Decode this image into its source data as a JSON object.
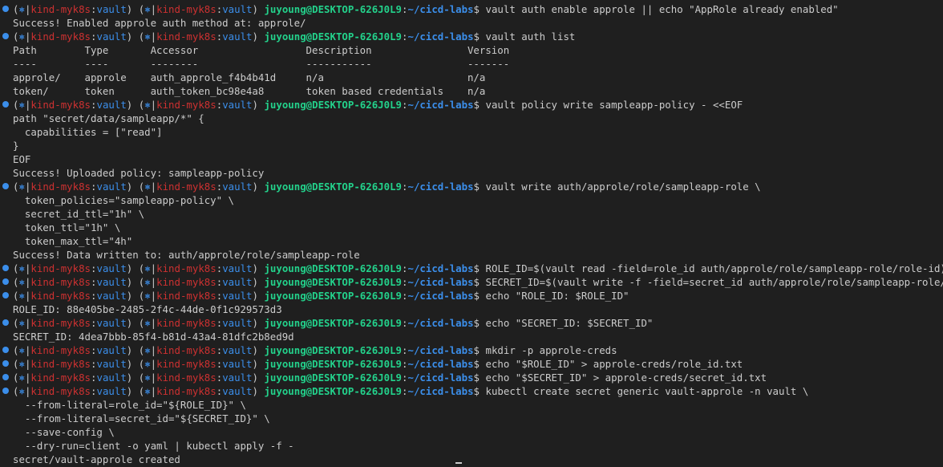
{
  "prompt": {
    "gear": "⎈",
    "bar": "|",
    "cluster": "kind-myk8s",
    "namespace": "vault",
    "user_host": "juyoung@DESKTOP-626J0L9",
    "cwd": "~/cicd-labs",
    "symbol": "$"
  },
  "lines": [
    {
      "kind": "prompt",
      "text": "vault auth enable approle || echo \"AppRole already enabled\""
    },
    {
      "kind": "output",
      "text": "Success! Enabled approle auth method at: approle/"
    },
    {
      "kind": "prompt",
      "text": "vault auth list"
    },
    {
      "kind": "output",
      "text": "Path        Type       Accessor                  Description                Version"
    },
    {
      "kind": "output",
      "text": "----        ----       --------                  -----------                -------"
    },
    {
      "kind": "output",
      "text": "approle/    approle    auth_approle_f4b4b41d     n/a                        n/a"
    },
    {
      "kind": "output",
      "text": "token/      token      auth_token_bc98e4a8       token based credentials    n/a"
    },
    {
      "kind": "prompt",
      "text": "vault policy write sampleapp-policy - <<EOF"
    },
    {
      "kind": "output",
      "text": "path \"secret/data/sampleapp/*\" {"
    },
    {
      "kind": "output",
      "text": "  capabilities = [\"read\"]"
    },
    {
      "kind": "output",
      "text": "}"
    },
    {
      "kind": "output",
      "text": "EOF"
    },
    {
      "kind": "output",
      "text": "Success! Uploaded policy: sampleapp-policy"
    },
    {
      "kind": "prompt",
      "text": "vault write auth/approle/role/sampleapp-role \\"
    },
    {
      "kind": "output",
      "text": "  token_policies=\"sampleapp-policy\" \\"
    },
    {
      "kind": "output",
      "text": "  secret_id_ttl=\"1h\" \\"
    },
    {
      "kind": "output",
      "text": "  token_ttl=\"1h\" \\"
    },
    {
      "kind": "output",
      "text": "  token_max_ttl=\"4h\""
    },
    {
      "kind": "output",
      "text": "Success! Data written to: auth/approle/role/sampleapp-role"
    },
    {
      "kind": "prompt",
      "text": "ROLE_ID=$(vault read -field=role_id auth/approle/role/sampleapp-role/role-id)"
    },
    {
      "kind": "prompt",
      "text": "SECRET_ID=$(vault write -f -field=secret_id auth/approle/role/sampleapp-role/secret-id)"
    },
    {
      "kind": "prompt",
      "text": "echo \"ROLE_ID: $ROLE_ID\""
    },
    {
      "kind": "output",
      "text": "ROLE_ID: 88e405be-2485-2f4c-44de-0f1c929573d3"
    },
    {
      "kind": "prompt",
      "text": "echo \"SECRET_ID: $SECRET_ID\""
    },
    {
      "kind": "output",
      "text": "SECRET_ID: 4dea7bbb-85f4-b81d-43a4-81dfc2b8ed9d"
    },
    {
      "kind": "prompt",
      "text": "mkdir -p approle-creds"
    },
    {
      "kind": "prompt",
      "text": "echo \"$ROLE_ID\" > approle-creds/role_id.txt"
    },
    {
      "kind": "prompt",
      "text": "echo \"$SECRET_ID\" > approle-creds/secret_id.txt"
    },
    {
      "kind": "prompt",
      "text": "kubectl create secret generic vault-approle -n vault \\"
    },
    {
      "kind": "output",
      "text": "  --from-literal=role_id=\"${ROLE_ID}\" \\"
    },
    {
      "kind": "output",
      "text": "  --from-literal=secret_id=\"${SECRET_ID}\" \\"
    },
    {
      "kind": "output",
      "text": "  --save-config \\"
    },
    {
      "kind": "output",
      "text": "  --dry-run=client -o yaml | kubectl apply -f -"
    },
    {
      "kind": "output",
      "text": "secret/vault-approle created"
    }
  ]
}
